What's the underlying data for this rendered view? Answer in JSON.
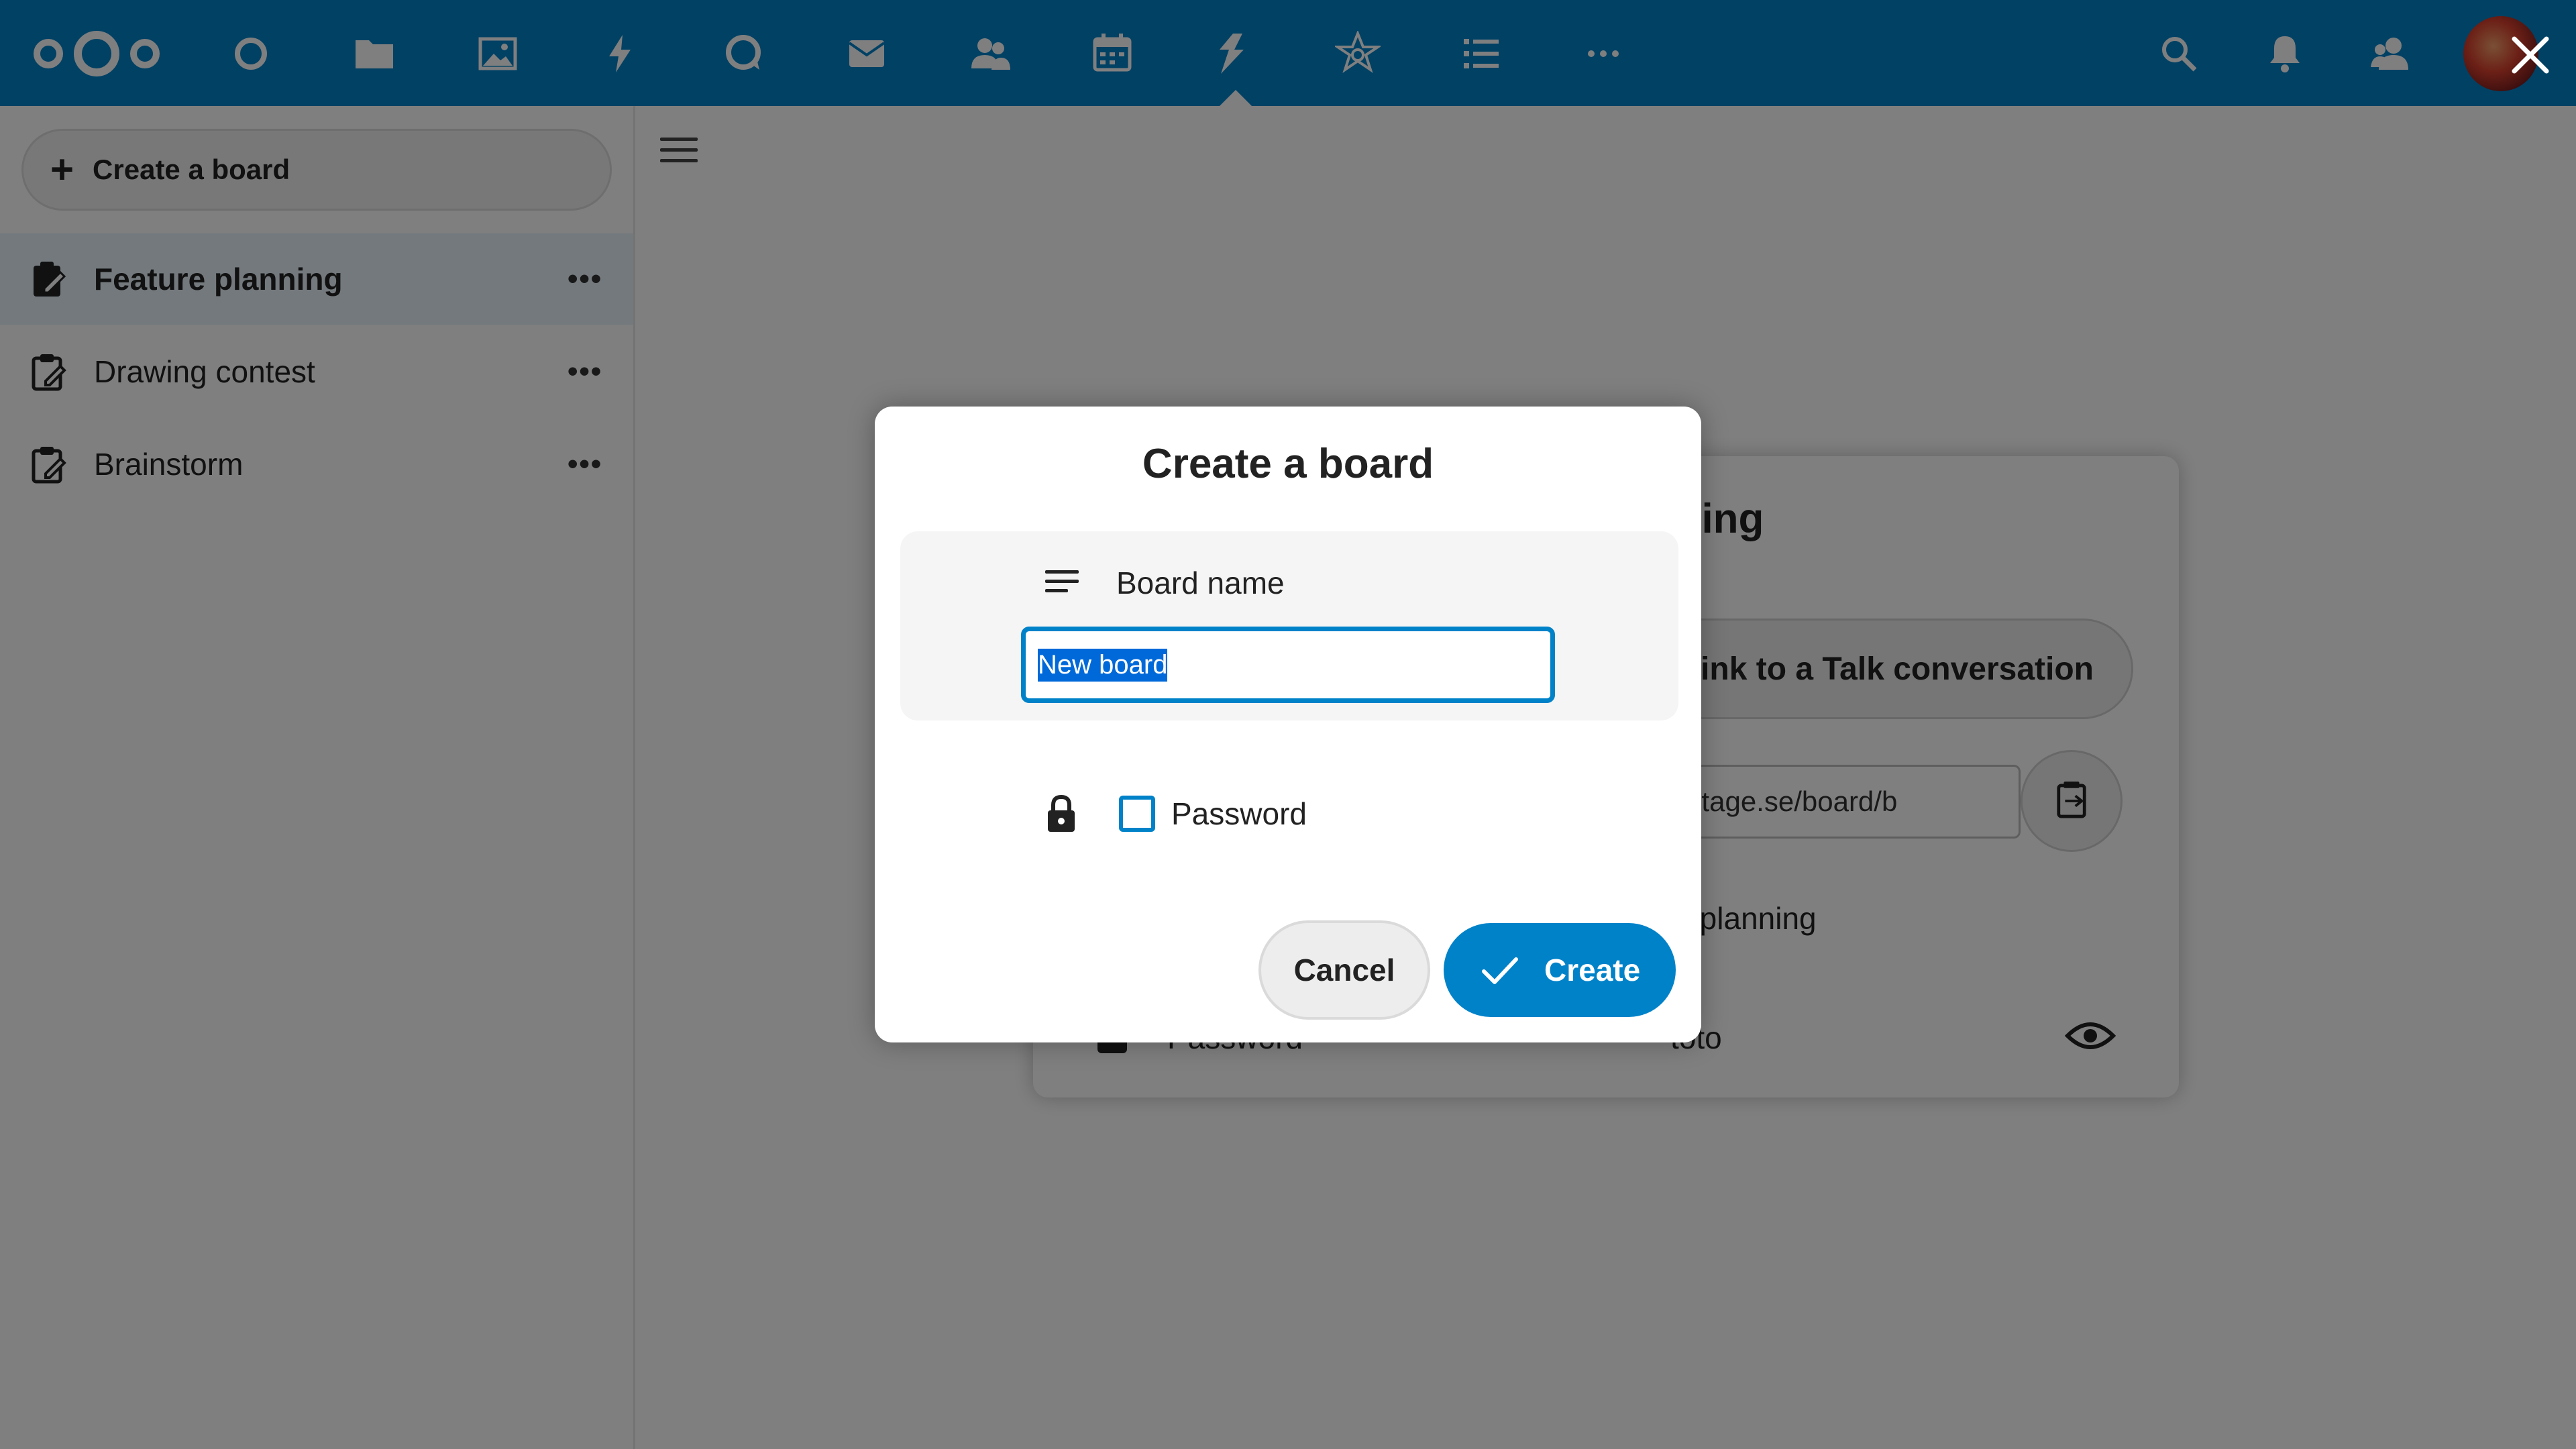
{
  "topbar": {
    "logo": "nextcloud-logo",
    "apps": [
      "dashboard-icon",
      "files-icon",
      "photos-icon",
      "activity-icon",
      "talk-icon",
      "mail-icon",
      "contacts-icon",
      "calendar-icon",
      "deck-icon",
      "assistant-icon",
      "tasks-icon",
      "more-apps-icon"
    ],
    "right_icons": [
      "search-icon",
      "notifications-icon",
      "contacts-menu-icon",
      "user-avatar"
    ],
    "active_app": "deck-icon"
  },
  "sidebar": {
    "create_label": "Create a board",
    "items": [
      {
        "label": "Feature planning",
        "active": true
      },
      {
        "label": "Drawing contest",
        "active": false
      },
      {
        "label": "Brainstorm",
        "active": false
      }
    ]
  },
  "background_dialog": {
    "title_fragment": "ning",
    "talk_button": "link to a Talk conversation",
    "link_value": "nuiteqstage.se/board/b",
    "description_fragment": "re planning",
    "password_label": "Password",
    "password_value": "toto"
  },
  "modal": {
    "title": "Create a board",
    "board_name_label": "Board name",
    "board_name_value": "New board",
    "password_label": "Password",
    "cancel_label": "Cancel",
    "create_label": "Create"
  },
  "colors": {
    "primary": "#0082c9",
    "overlay": "rgba(0,0,0,0.5)"
  }
}
